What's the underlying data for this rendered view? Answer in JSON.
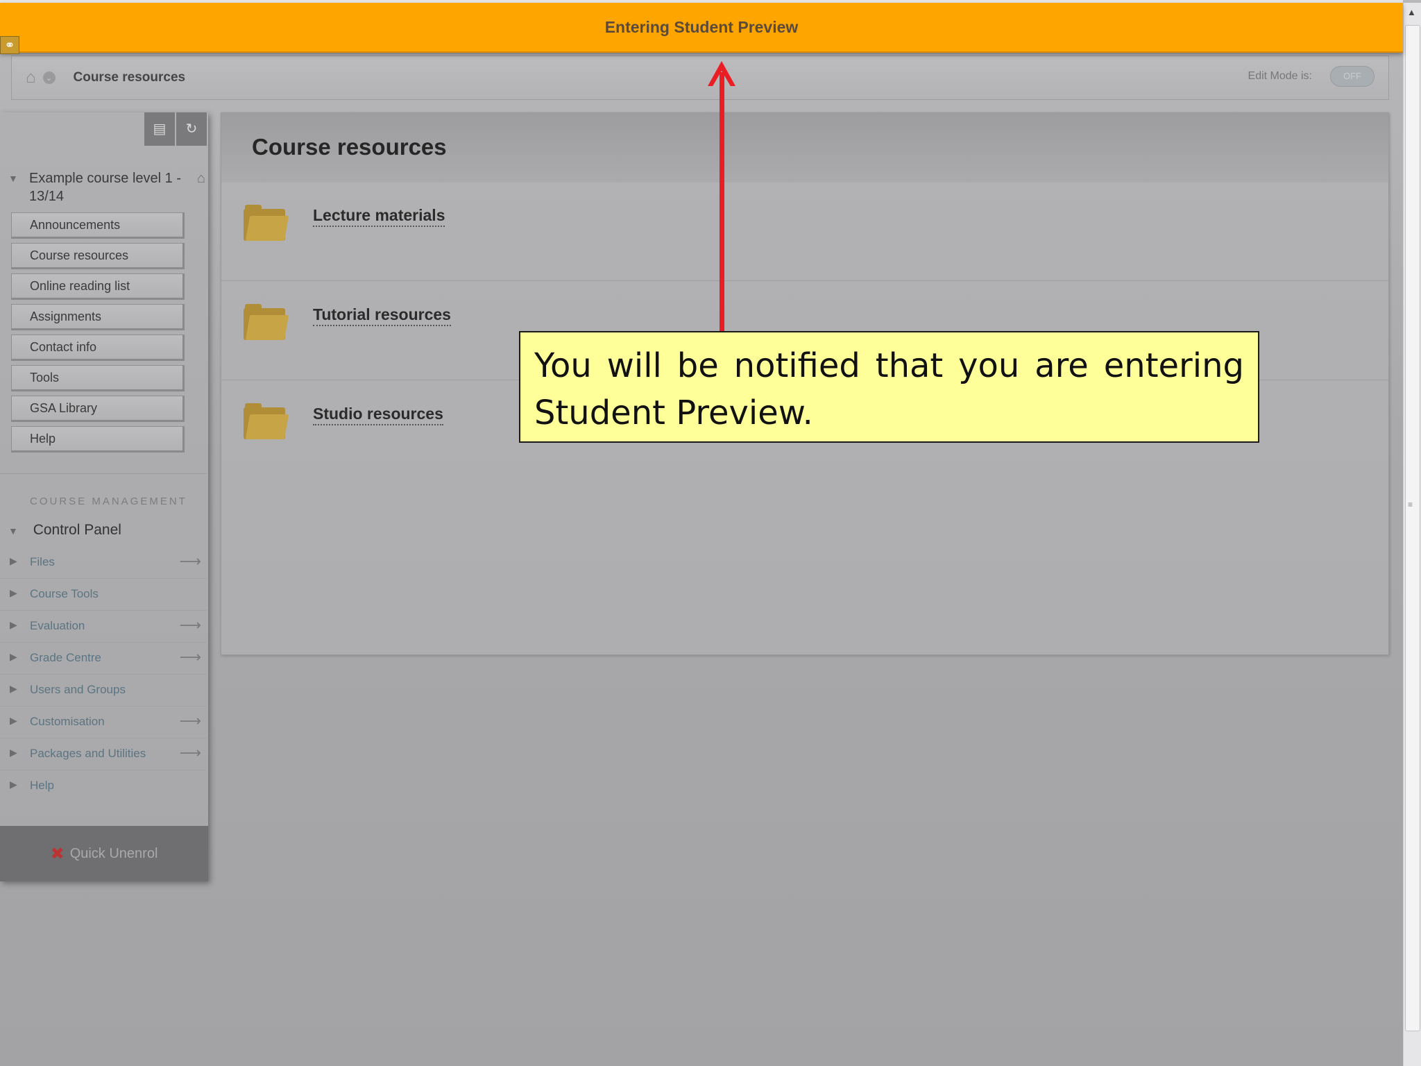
{
  "banner": {
    "title": "Entering Student Preview"
  },
  "breadcrumb": {
    "current": "Course resources",
    "edit_mode_label": "Edit Mode is:",
    "edit_mode_value": "OFF"
  },
  "course_menu": {
    "course_title": "Example course level 1 - 13/14",
    "items": [
      {
        "label": "Announcements"
      },
      {
        "label": "Course resources"
      },
      {
        "label": "Online reading list"
      },
      {
        "label": "Assignments"
      },
      {
        "label": "Contact info"
      },
      {
        "label": "Tools"
      },
      {
        "label": "GSA Library"
      },
      {
        "label": "Help"
      }
    ],
    "management_heading": "COURSE MANAGEMENT",
    "control_panel_label": "Control Panel",
    "control_panel_items": [
      {
        "label": "Files",
        "has_go": true
      },
      {
        "label": "Course Tools",
        "has_go": false
      },
      {
        "label": "Evaluation",
        "has_go": true
      },
      {
        "label": "Grade Centre",
        "has_go": true
      },
      {
        "label": "Users and Groups",
        "has_go": false
      },
      {
        "label": "Customisation",
        "has_go": true
      },
      {
        "label": "Packages and Utilities",
        "has_go": true
      },
      {
        "label": "Help",
        "has_go": false
      }
    ],
    "quick_unenrol_label": "Quick Unenrol"
  },
  "content": {
    "page_title": "Course resources",
    "items": [
      {
        "label": "Lecture materials",
        "icon": "folder-icon"
      },
      {
        "label": "Tutorial resources",
        "icon": "folder-icon"
      },
      {
        "label": "Studio resources",
        "icon": "folder-icon"
      }
    ]
  },
  "annotation": {
    "text": "You will be notified that you are entering Student Preview.",
    "arrow_color": "#ea1c24",
    "box_color": "#ffff99"
  },
  "colors": {
    "banner": "#ffa500",
    "link_text": "#5b7482"
  }
}
